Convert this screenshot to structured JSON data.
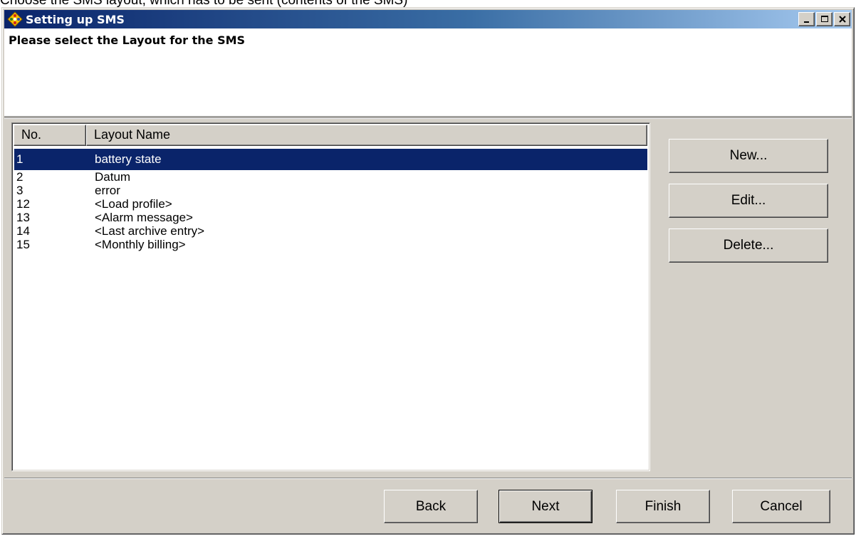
{
  "caption_text": "Choose the SMS layout, which has to be sent (contents of the SMS)",
  "window": {
    "title": "Setting up SMS",
    "controls": {
      "minimize": "minimize",
      "maximize": "maximize",
      "close": "close"
    }
  },
  "header": {
    "instruction": "Please select the Layout for the SMS"
  },
  "list": {
    "columns": [
      "No.",
      "Layout Name"
    ],
    "rows": [
      {
        "no": "1",
        "name": "battery state",
        "selected": true
      },
      {
        "no": "2",
        "name": "Datum",
        "selected": false
      },
      {
        "no": "3",
        "name": "error",
        "selected": false
      },
      {
        "no": "12",
        "name": "<Load profile>",
        "selected": false
      },
      {
        "no": "13",
        "name": "<Alarm message>",
        "selected": false
      },
      {
        "no": "14",
        "name": "<Last archive entry>",
        "selected": false
      },
      {
        "no": "15",
        "name": "<Monthly billing>",
        "selected": false
      }
    ]
  },
  "side_buttons": {
    "new": "New...",
    "edit": "Edit...",
    "delete": "Delete..."
  },
  "footer_buttons": {
    "back": "Back",
    "next": "Next",
    "finish": "Finish",
    "cancel": "Cancel"
  },
  "colors": {
    "selection": "#0a246a",
    "face": "#d4d0c8",
    "title_start": "#0a246a",
    "title_end": "#a6caf0"
  },
  "icons": {
    "app": "sms-wizard-icon"
  }
}
